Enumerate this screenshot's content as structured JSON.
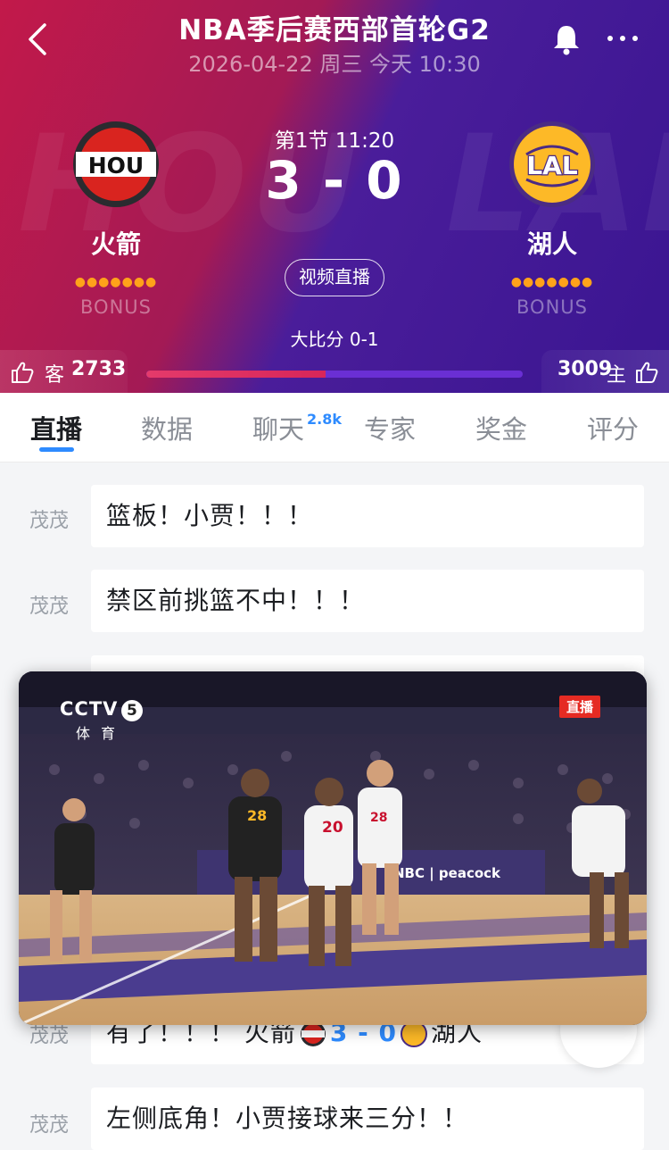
{
  "header": {
    "title": "NBA季后赛西部首轮G2",
    "datetime": "2026-04-22 周三 今天 10:30",
    "period_clock": "第1节 11:20",
    "score": "3 - 0",
    "live_button": "视频直播",
    "series_score": "大比分 0-1",
    "watermark_away": "HOU",
    "watermark_home": "LAL"
  },
  "away_team": {
    "abbr": "HOU",
    "name": "火箭",
    "bonus_label": "BONUS",
    "bonus_dots": "●●●●●●●",
    "side_label": "客",
    "likes": "2733",
    "color": "#c2194a"
  },
  "home_team": {
    "abbr": "LAL",
    "name": "湖人",
    "bonus_label": "BONUS",
    "bonus_dots": "●●●●●●●",
    "side_label": "主",
    "likes": "3009",
    "color": "#4a1d9a"
  },
  "vote_ratio_away": 0.476,
  "tabs": [
    {
      "label": "直播",
      "active": true
    },
    {
      "label": "数据"
    },
    {
      "label": "聊天",
      "badge": "2.8k"
    },
    {
      "label": "专家"
    },
    {
      "label": "奖金"
    },
    {
      "label": "评分"
    }
  ],
  "feed": [
    {
      "author": "茂茂",
      "text": "篮板！小贾！！！"
    },
    {
      "author": "茂茂",
      "text": "禁区前挑篮不中！！！"
    },
    {
      "author": "茂茂",
      "text_prefix": "有了！！！  火箭",
      "score": "3 - 0",
      "text_suffix": "湖人"
    },
    {
      "author": "茂茂",
      "text": "左侧底角！小贾接球来三分！！"
    }
  ],
  "video": {
    "channel": "CCTV",
    "channel_number": "5",
    "channel_sub": "体育",
    "live_tag": "直播",
    "court_ad": "NBC | peacock",
    "jersey_numbers": [
      "28",
      "20",
      "28"
    ]
  },
  "colors": {
    "accent": "#2e8bff",
    "bonus": "#ffa21a",
    "live_red": "#e52b23"
  },
  "icons": [
    "back-arrow-icon",
    "bell-icon",
    "more-icon",
    "thumbs-up-icon",
    "hou-logo-icon",
    "lal-logo-icon"
  ]
}
